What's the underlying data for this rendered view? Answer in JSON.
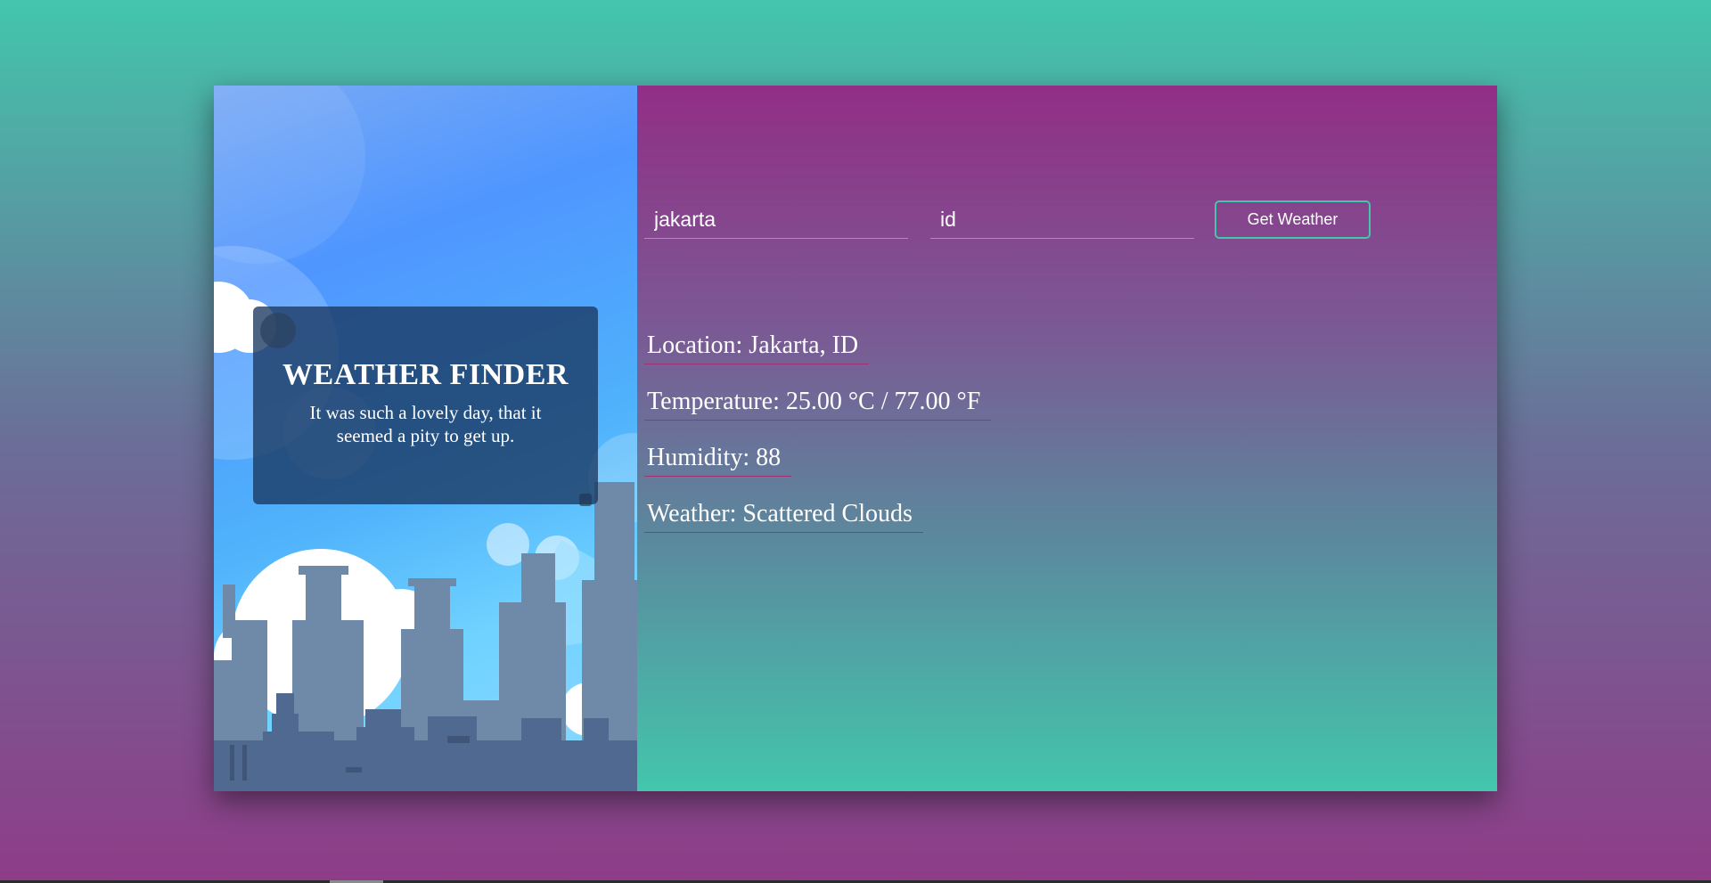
{
  "form": {
    "city_value": "jakarta",
    "country_value": "id",
    "button_label": "Get Weather"
  },
  "hero": {
    "title": "WEATHER FINDER",
    "subtitle": "It was such a lovely day, that it seemed a pity to get up."
  },
  "results": {
    "location": "Location: Jakarta, ID",
    "temperature": "Temperature: 25.00 °C / 77.00 °F",
    "humidity": "Humidity: 88",
    "weather": "Weather: Scattered Clouds"
  },
  "colors": {
    "accent": "#43c6ac",
    "magenta": "#922e86",
    "panel_overlay": "#1a375f"
  }
}
